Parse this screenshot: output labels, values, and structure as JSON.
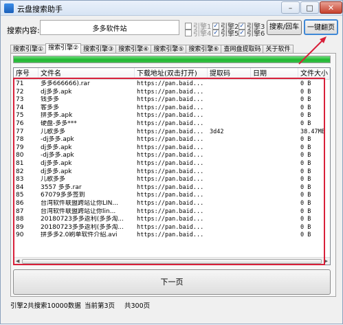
{
  "window": {
    "title": "云盘搜索助手",
    "minimize": "–",
    "maximize": "□",
    "close": "✕"
  },
  "search": {
    "label": "搜索内容:",
    "value": "多多软件站"
  },
  "engines": [
    {
      "label": "引擎1",
      "checked": false
    },
    {
      "label": "引擎2",
      "checked": true
    },
    {
      "label": "引擎3",
      "checked": true
    },
    {
      "label": "引擎4",
      "checked": false
    },
    {
      "label": "引擎5",
      "checked": true
    },
    {
      "label": "引擎6",
      "checked": true
    }
  ],
  "buttons": {
    "search": "搜索/回车",
    "page_all": "一键翻页",
    "next_page": "下一页"
  },
  "tabs": [
    "搜索引擎①",
    "搜索引擎②",
    "搜索引擎③",
    "搜索引擎④",
    "搜索引擎⑤",
    "搜索引擎⑥",
    "查网盘提取码",
    "关于软件"
  ],
  "active_tab": 1,
  "progress": {
    "percent": 100,
    "color": "#20b630"
  },
  "columns": [
    "序号",
    "文件名",
    "下载地址(双击打开)",
    "提取码",
    "日期",
    "文件大小"
  ],
  "rows": [
    {
      "no": "71",
      "name": "多多666666).rar",
      "link": "https://pan.baid...",
      "code": "",
      "date": "",
      "size": "0 B"
    },
    {
      "no": "72",
      "name": "dj多多.apk",
      "link": "https://pan.baid...",
      "code": "",
      "date": "",
      "size": "0 B"
    },
    {
      "no": "73",
      "name": "钱多多",
      "link": "https://pan.baid...",
      "code": "",
      "date": "",
      "size": "0 B"
    },
    {
      "no": "74",
      "name": "客多多",
      "link": "https://pan.baid...",
      "code": "",
      "date": "",
      "size": "0 B"
    },
    {
      "no": "75",
      "name": "拼多多.apk",
      "link": "https://pan.baid...",
      "code": "",
      "date": "",
      "size": "0 B"
    },
    {
      "no": "76",
      "name": "硬盘-多多***",
      "link": "https://pan.baid...",
      "code": "",
      "date": "",
      "size": "0 B"
    },
    {
      "no": "77",
      "name": "儿歌多多",
      "link": "https://pan.baid...",
      "code": "3d42",
      "date": "",
      "size": "38.47MB"
    },
    {
      "no": "78",
      "name": "-dj多多.apk",
      "link": "https://pan.baid...",
      "code": "",
      "date": "",
      "size": "0 B"
    },
    {
      "no": "79",
      "name": "dj多多.apk",
      "link": "https://pan.baid...",
      "code": "",
      "date": "",
      "size": "0 B"
    },
    {
      "no": "80",
      "name": "-dj多多.apk",
      "link": "https://pan.baid...",
      "code": "",
      "date": "",
      "size": "0 B"
    },
    {
      "no": "81",
      "name": "dj多多.apk",
      "link": "https://pan.baid...",
      "code": "",
      "date": "",
      "size": "0 B"
    },
    {
      "no": "82",
      "name": "dj多多.apk",
      "link": "https://pan.baid...",
      "code": "",
      "date": "",
      "size": "0 B"
    },
    {
      "no": "83",
      "name": "儿歌多多",
      "link": "https://pan.baid...",
      "code": "",
      "date": "",
      "size": "0 B"
    },
    {
      "no": "84",
      "name": "3557 多多.rar",
      "link": "https://pan.baid...",
      "code": "",
      "date": "",
      "size": "0 B"
    },
    {
      "no": "85",
      "name": "67079多多签到",
      "link": "https://pan.baid...",
      "code": "",
      "date": "",
      "size": "0 B"
    },
    {
      "no": "86",
      "name": "台湾软件联盟跨站让你LIN...",
      "link": "https://pan.baid...",
      "code": "",
      "date": "",
      "size": "0 B"
    },
    {
      "no": "87",
      "name": "台湾软件联盟跨站让你lin...",
      "link": "https://pan.baid...",
      "code": "",
      "date": "",
      "size": "0 B"
    },
    {
      "no": "88",
      "name": "20180723多多返利(多多淘...",
      "link": "https://pan.baid...",
      "code": "",
      "date": "",
      "size": "0 B"
    },
    {
      "no": "89",
      "name": "20180723多多返利(多多淘...",
      "link": "https://pan.baid...",
      "code": "",
      "date": "",
      "size": "0 B"
    },
    {
      "no": "90",
      "name": "拼多多2.0刷单软件介绍.avi",
      "link": "https://pan.baid...",
      "code": "",
      "date": "",
      "size": "0 B"
    }
  ],
  "status": {
    "summary": "引擎2共搜索10000数据",
    "current_page": "当前第3页",
    "total_pages": "共300页"
  },
  "colors": {
    "highlight": "#d8203a",
    "accent": "#3f88d6"
  }
}
